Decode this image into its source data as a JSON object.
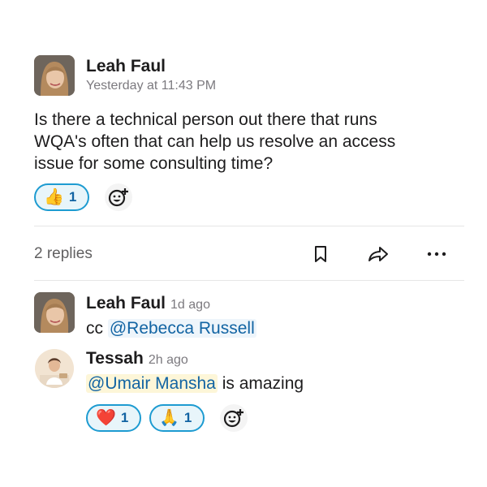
{
  "message": {
    "author": "Leah Faul",
    "timestamp": "Yesterday at 11:43 PM",
    "text_lines": [
      "Is there a technical person out there that runs",
      "WQA's often that can help us resolve an access",
      "issue for some consulting time?"
    ],
    "reactions": [
      {
        "emoji": "👍",
        "count": "1"
      }
    ]
  },
  "thread_bar": {
    "replies_label": "2 replies"
  },
  "replies": [
    {
      "author": "Leah Faul",
      "timestamp": "1d ago",
      "prefix": "cc ",
      "mention": "@Rebecca Russell",
      "suffix": ""
    },
    {
      "author": "Tessah",
      "timestamp": "2h ago",
      "prefix": "",
      "mention": "@Umair Mansha",
      "suffix": " is amazing",
      "reactions": [
        {
          "emoji": "❤️",
          "count": "1"
        },
        {
          "emoji": "🙏",
          "count": "1"
        }
      ]
    }
  ],
  "icons": [
    "avatar",
    "add-reaction-icon",
    "bookmark-icon",
    "share-icon",
    "more-icon"
  ],
  "colors": {
    "mention": "#1264a3",
    "reaction_border": "#1d9bd1",
    "reaction_bg": "#e8f5fa"
  }
}
